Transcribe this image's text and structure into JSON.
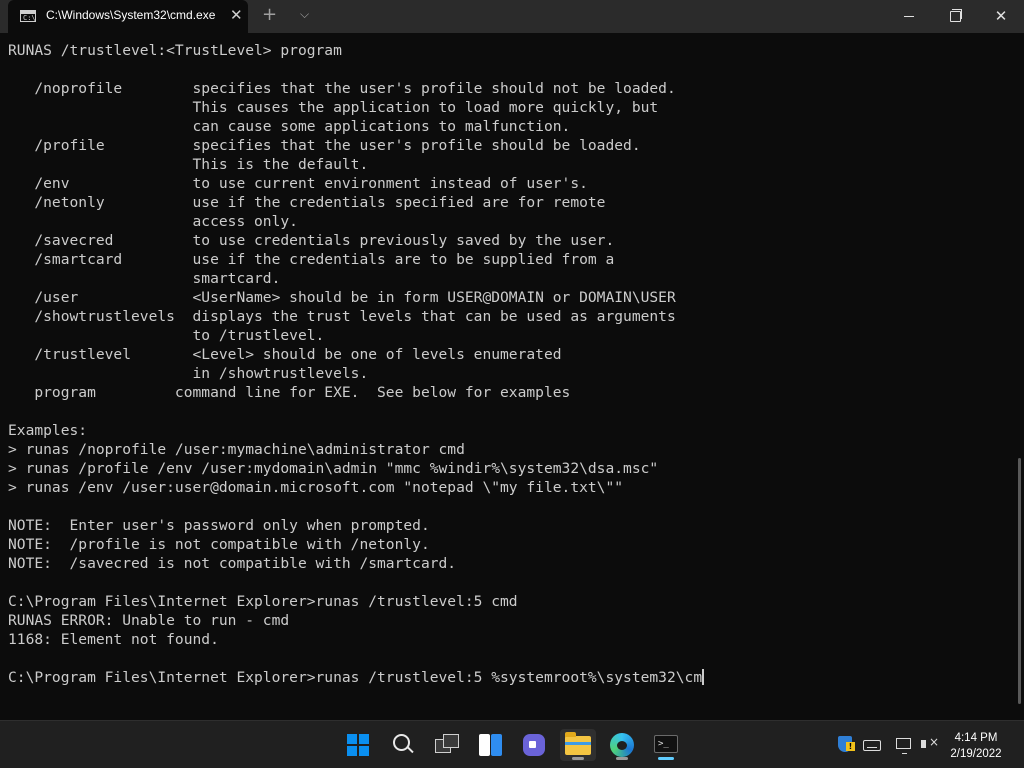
{
  "window": {
    "tab_title": "C:\\Windows\\System32\\cmd.exe",
    "tab_icon_text": "C:\\",
    "close_tab_glyph": "✕",
    "new_tab_glyph": "+",
    "dropdown_glyph": "⌵",
    "close_glyph": "✕"
  },
  "console": {
    "lines": [
      "RUNAS /trustlevel:<TrustLevel> program",
      "",
      "   /noprofile        specifies that the user's profile should not be loaded.",
      "                     This causes the application to load more quickly, but",
      "                     can cause some applications to malfunction.",
      "   /profile          specifies that the user's profile should be loaded.",
      "                     This is the default.",
      "   /env              to use current environment instead of user's.",
      "   /netonly          use if the credentials specified are for remote",
      "                     access only.",
      "   /savecred         to use credentials previously saved by the user.",
      "   /smartcard        use if the credentials are to be supplied from a",
      "                     smartcard.",
      "   /user             <UserName> should be in form USER@DOMAIN or DOMAIN\\USER",
      "   /showtrustlevels  displays the trust levels that can be used as arguments",
      "                     to /trustlevel.",
      "   /trustlevel       <Level> should be one of levels enumerated",
      "                     in /showtrustlevels.",
      "   program         command line for EXE.  See below for examples",
      "",
      "Examples:",
      "> runas /noprofile /user:mymachine\\administrator cmd",
      "> runas /profile /env /user:mydomain\\admin \"mmc %windir%\\system32\\dsa.msc\"",
      "> runas /env /user:user@domain.microsoft.com \"notepad \\\"my file.txt\\\"\"",
      "",
      "NOTE:  Enter user's password only when prompted.",
      "NOTE:  /profile is not compatible with /netonly.",
      "NOTE:  /savecred is not compatible with /smartcard.",
      "",
      "C:\\Program Files\\Internet Explorer>runas /trustlevel:5 cmd",
      "RUNAS ERROR: Unable to run - cmd",
      "1168: Element not found.",
      "",
      "C:\\Program Files\\Internet Explorer>runas /trustlevel:5 %systemroot%\\system32\\cm"
    ]
  },
  "taskbar": {
    "apps": [
      {
        "name": "start-button",
        "icon": "windows-logo-icon"
      },
      {
        "name": "search-button",
        "icon": "search-icon"
      },
      {
        "name": "task-view-button",
        "icon": "task-view-icon"
      },
      {
        "name": "widgets-button",
        "icon": "widgets-icon"
      },
      {
        "name": "chat-button",
        "icon": "chat-icon"
      },
      {
        "name": "file-explorer-button",
        "icon": "folder-icon"
      },
      {
        "name": "edge-button",
        "icon": "edge-icon"
      },
      {
        "name": "terminal-button",
        "icon": "terminal-icon"
      }
    ],
    "terminal_glyph": ">_",
    "clock": {
      "time": "4:14 PM",
      "date": "2/19/2022"
    }
  },
  "colors": {
    "console_bg": "#0c0c0c",
    "console_fg": "#cccccc",
    "titlebar_bg": "#2b2b2b",
    "taskbar_bg": "#202020",
    "accent": "#60cdff"
  }
}
